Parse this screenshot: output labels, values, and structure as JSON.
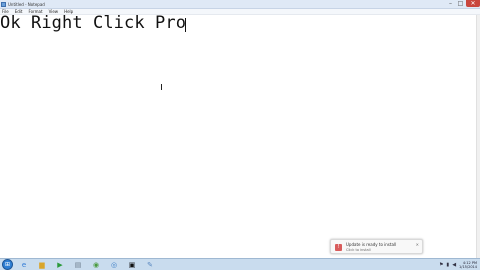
{
  "window": {
    "title": "Untitled - Notepad",
    "icon": "notepad-icon",
    "controls": {
      "minimize": "–",
      "maximize": "□",
      "close": "✕"
    }
  },
  "menubar": {
    "items": [
      "File",
      "Edit",
      "Format",
      "View",
      "Help"
    ]
  },
  "editor": {
    "text": "Ok Right Click Pro"
  },
  "notification": {
    "title": "Update is ready to install",
    "subtitle": "Click to install"
  },
  "taskbar": {
    "start_icon": "windows-start-icon",
    "pinned": [
      {
        "name": "internet-explorer-icon",
        "glyph": "e"
      },
      {
        "name": "folder-icon",
        "glyph": "▆"
      },
      {
        "name": "media-player-icon",
        "glyph": "▶"
      },
      {
        "name": "document-icon",
        "glyph": "▤"
      },
      {
        "name": "green-app-icon",
        "glyph": "◉"
      },
      {
        "name": "chrome-icon",
        "glyph": "◎"
      },
      {
        "name": "cmd-icon",
        "glyph": "▣"
      },
      {
        "name": "notepad-icon",
        "glyph": "✎"
      }
    ],
    "tray": {
      "icons": [
        "flag-icon",
        "network-icon",
        "volume-icon"
      ],
      "time": "4:12 PM",
      "date": "1/15/2014"
    }
  },
  "colors": {
    "close_button": "#c9463d",
    "taskbar": "#c9dcee",
    "notification_icon": "#d85c5c"
  }
}
